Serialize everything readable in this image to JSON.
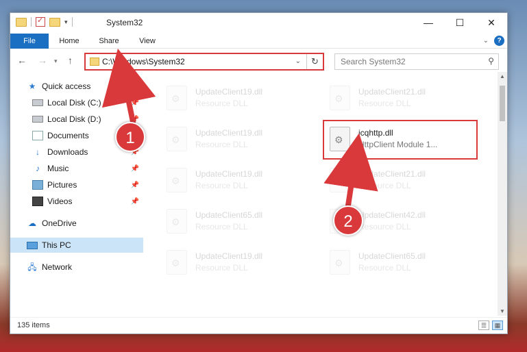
{
  "window": {
    "title": "System32"
  },
  "title_buttons": {
    "minimize": "—",
    "maximize": "☐",
    "close": "✕"
  },
  "ribbon": {
    "tabs": [
      {
        "label": "File"
      },
      {
        "label": "Home"
      },
      {
        "label": "Share"
      },
      {
        "label": "View"
      }
    ]
  },
  "address": {
    "path": "C:\\Windows\\System32"
  },
  "search": {
    "placeholder": "Search System32"
  },
  "sidebar": {
    "items": [
      {
        "label": "Quick access",
        "icon": "star-icon"
      },
      {
        "label": "Local Disk (C:)",
        "icon": "drive-icon"
      },
      {
        "label": "Local Disk (D:)",
        "icon": "drive-icon"
      },
      {
        "label": "Documents",
        "icon": "documents-icon"
      },
      {
        "label": "Downloads",
        "icon": "downloads-icon"
      },
      {
        "label": "Music",
        "icon": "music-icon"
      },
      {
        "label": "Pictures",
        "icon": "pictures-icon"
      },
      {
        "label": "Videos",
        "icon": "videos-icon"
      },
      {
        "label": "OneDrive",
        "icon": "onedrive-icon"
      },
      {
        "label": "This PC",
        "icon": "pc-icon"
      },
      {
        "label": "Network",
        "icon": "network-icon"
      }
    ]
  },
  "files": [
    {
      "name": "UpdateClient19.dll",
      "desc": "Resource DLL"
    },
    {
      "name": "UpdateClient21.dll",
      "desc": "Resource DLL"
    },
    {
      "name": "UpdateClient19.dll",
      "desc": "Resource DLL"
    },
    {
      "name": "icqhttp.dll",
      "desc": "HttpClient Module 1..."
    },
    {
      "name": "UpdateClient19.dll",
      "desc": "Resource DLL"
    },
    {
      "name": "UpdateClient21.dll",
      "desc": "Resource DLL"
    },
    {
      "name": "UpdateClient65.dll",
      "desc": "Resource DLL"
    },
    {
      "name": "UpdateClient42.dll",
      "desc": "Resource DLL"
    },
    {
      "name": "UpdateClient19.dll",
      "desc": "Resource DLL"
    },
    {
      "name": "UpdateClient65.dll",
      "desc": "Resource DLL"
    }
  ],
  "status": {
    "item_count": "135 items"
  },
  "annotations": {
    "step1": "1",
    "step2": "2"
  },
  "colors": {
    "accent": "#1a6fc2",
    "highlight": "#d9393b",
    "selection": "#cce4f7"
  }
}
